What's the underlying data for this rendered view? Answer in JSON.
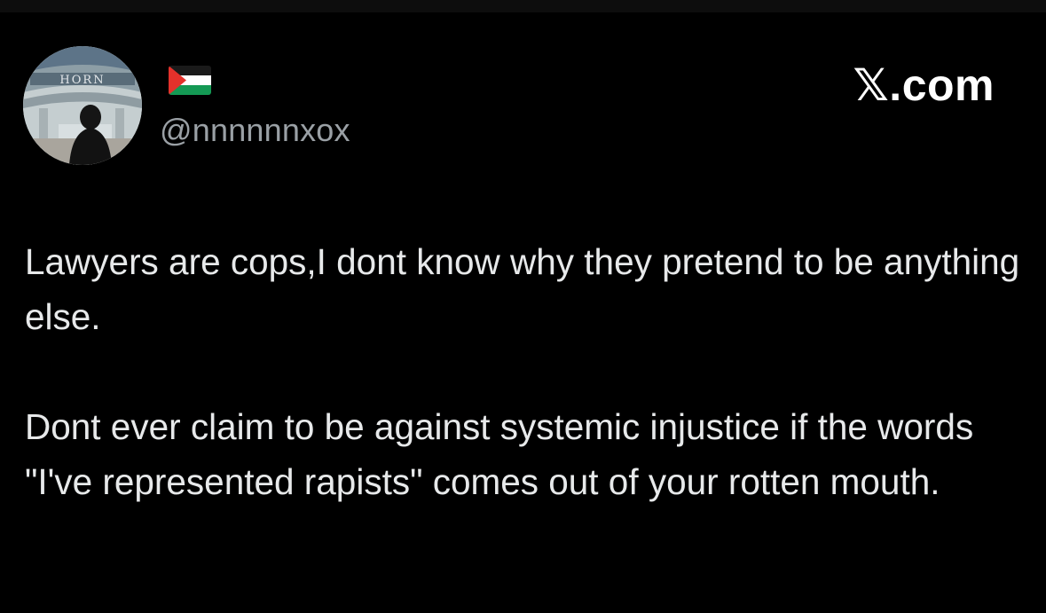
{
  "tweet": {
    "handle": "@nnnnnnxox",
    "brand": "𝕏.com",
    "paragraphs": [
      "Lawyers are cops,I dont know why they pretend to be anything else.",
      "Dont ever claim to be against systemic injustice if the words \"I've represented rapists\" comes out of your rotten mouth."
    ]
  },
  "avatar": {
    "icon": "profile-photo",
    "photo_sign_text": "HORN"
  },
  "flag": {
    "icon": "palestinian-flag",
    "colors": [
      "#000000",
      "#ffffff",
      "#149954",
      "#e4312b"
    ]
  },
  "colors": {
    "background": "#000000",
    "text": "#e7e9ea",
    "secondary_text": "#9aa0a5",
    "brand": "#ffffff"
  }
}
